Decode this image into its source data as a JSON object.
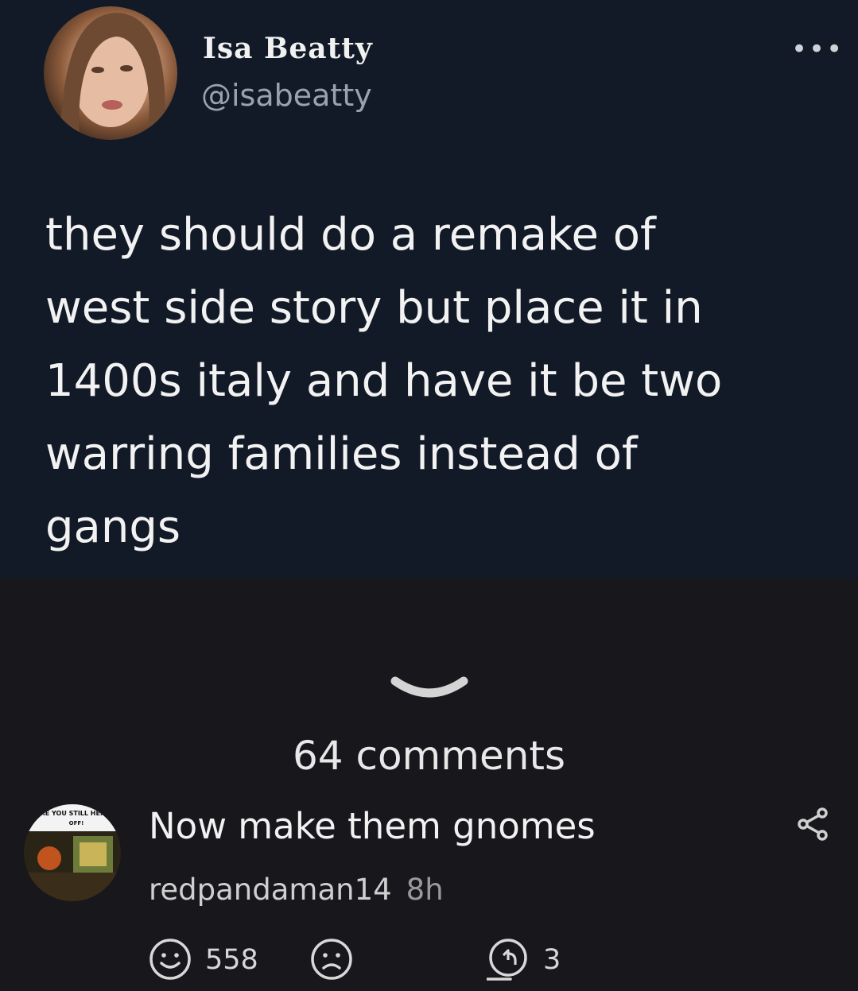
{
  "tweet": {
    "display_name": "Isa Beatty",
    "handle": "@isabeatty",
    "more_icon": "more-horizontal-icon",
    "text": "they should do a remake of\nwest side story but place it in\n1400s italy and have it be two\nwarring families instead of\ngangs"
  },
  "comments_header": "64 comments",
  "comment": {
    "text": "Now make them gnomes",
    "author": "redpandaman14",
    "time": "8h",
    "upvotes": "558",
    "replies": "3",
    "avatar_text_line1": "ARE YOU STILL HERE",
    "avatar_text_line2": "OFF!"
  },
  "colors": {
    "tweet_bg": "#131a27",
    "page_bg": "#17171c",
    "text": "#f2f2f2",
    "muted": "#9aa3ad"
  }
}
